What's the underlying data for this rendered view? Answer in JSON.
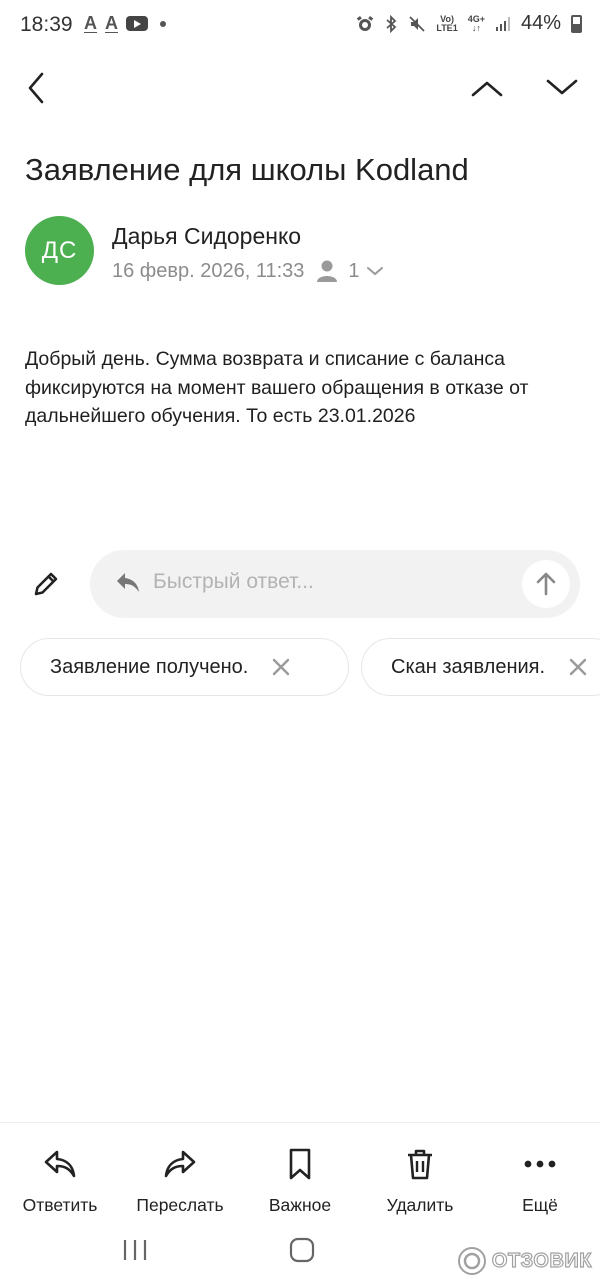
{
  "status_bar": {
    "time": "18:39",
    "battery": "44%",
    "network_top": "Vo)",
    "network_bottom": "LTE1",
    "network_type": "4G+"
  },
  "email": {
    "subject": "Заявление для школы Kodland",
    "sender": {
      "initials": "ДС",
      "name": "Дарья Сидоренко",
      "avatar_color": "#4caf50"
    },
    "date": "16 февр. 2026, 11:33",
    "recipients_count": "1",
    "body": "Добрый день. Сумма возврата и списание с баланса фиксируются на момент вашего обращения в отказе от дальнейшего обучения. То есть 23.01.2026"
  },
  "quick_reply": {
    "placeholder": "Быстрый ответ..."
  },
  "suggestions": [
    {
      "label": "Заявление получено."
    },
    {
      "label": "Скан заявления."
    }
  ],
  "actions": {
    "reply": "Ответить",
    "forward": "Переслать",
    "important": "Важное",
    "delete": "Удалить",
    "more": "Ещё"
  },
  "watermark": "ОТЗОВИК",
  "icons": {
    "back": "chevron-left-icon",
    "prev": "chevron-up-icon",
    "next": "chevron-down-icon",
    "edit": "pencil-icon",
    "reply": "reply-icon",
    "send": "arrow-up-icon",
    "forward": "forward-icon",
    "important": "bookmark-icon",
    "delete": "trash-icon",
    "more": "more-dots-icon"
  }
}
